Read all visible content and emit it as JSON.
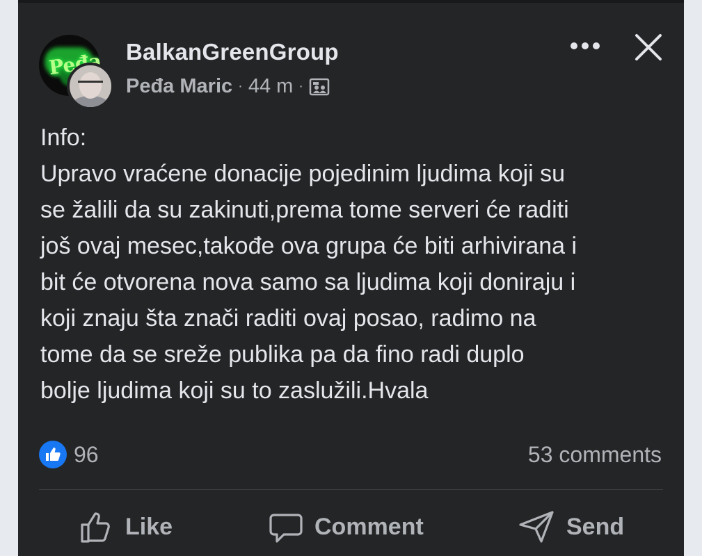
{
  "post": {
    "group_name": "BalkanGreenGroup",
    "author": "Peđa Maric",
    "time": "44 m",
    "separator": "·",
    "body_lines": [
      "Info:",
      "Upravo vraćene donacije pojedinim ljudima koji su",
      "se žalili da su zakinuti,prema tome serveri će raditi",
      "još ovaj mesec,takođe ova grupa će biti arhivirana i",
      "bit će otvorena nova samo sa ljudima koji doniraju i",
      "koji znaju šta znači raditi ovaj posao, radimo na",
      "tome da se sreže publika pa da fino radi duplo",
      "bolje ljudima koji su to zaslužili.Hvala"
    ],
    "reaction_count": "96",
    "comments_label": "53 comments"
  },
  "actions": {
    "like": "Like",
    "comment": "Comment",
    "send": "Send"
  },
  "icons": {
    "more": "more-options-icon",
    "close": "close-icon",
    "audience": "group-audience-icon",
    "like_reaction": "like-reaction-icon",
    "like": "thumbs-up-icon",
    "comment": "comment-bubble-icon",
    "send": "send-icon"
  },
  "colors": {
    "background": "#242526",
    "text_primary": "#e4e6eb",
    "text_secondary": "#b0b3b8",
    "like_blue": "#1877f2"
  }
}
